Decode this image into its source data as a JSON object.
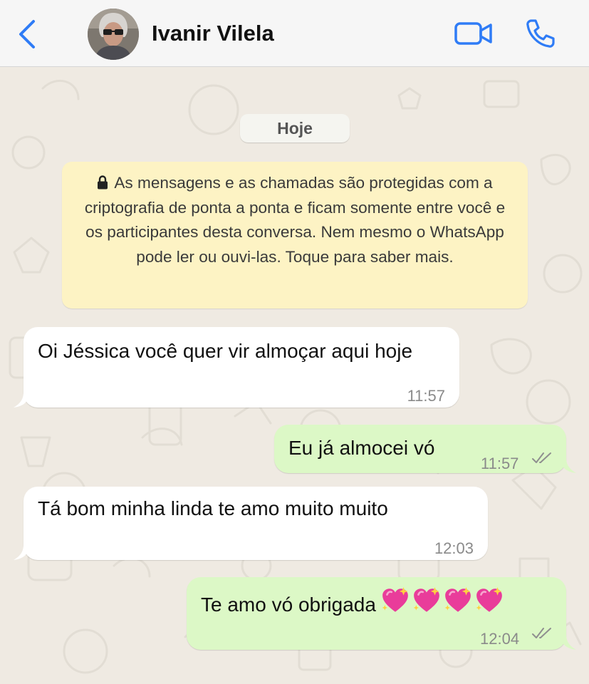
{
  "header": {
    "contact_name": "Ivanir Vilela",
    "accent_color": "#2f7cf6"
  },
  "chat": {
    "date_label": "Hoje",
    "encryption_notice": "As mensagens e as chamadas são protegidas com a criptografia de ponta a ponta e ficam somente entre você e os participantes desta conversa. Nem mesmo o WhatsApp pode ler ou ouvi-las. Toque para saber mais.",
    "messages": [
      {
        "direction": "incoming",
        "text": "Oi Jéssica você quer vir almoçar aqui hoje",
        "time": "11:57"
      },
      {
        "direction": "outgoing",
        "text": "Eu já almocei vó",
        "time": "11:57",
        "status": "read"
      },
      {
        "direction": "incoming",
        "text": "Tá bom minha linda te amo muito muito",
        "time": "12:03"
      },
      {
        "direction": "outgoing",
        "text": "Te amo vó obrigada",
        "time": "12:04",
        "status": "read",
        "emojis": [
          "sparkling-heart",
          "sparkling-heart",
          "sparkling-heart",
          "sparkling-heart"
        ]
      }
    ]
  },
  "icons": {
    "back": "chevron-left-icon",
    "video": "video-camera-icon",
    "call": "phone-icon",
    "lock": "lock-icon",
    "status": "double-check-icon"
  },
  "colors": {
    "outgoing_bubble": "#dcf8c6",
    "incoming_bubble": "#ffffff",
    "notice_bubble": "#fdf3c4",
    "wallpaper": "#efeae2",
    "heart": "#e93c9a"
  }
}
